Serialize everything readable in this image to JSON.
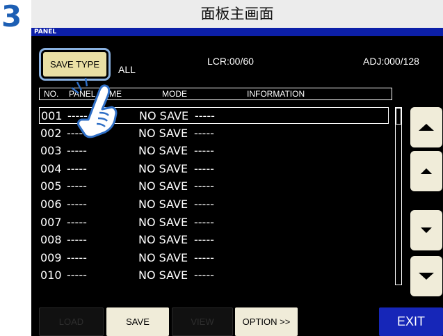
{
  "step_number": "3",
  "caption": "面板主画面",
  "screen": {
    "window_title": "PANEL",
    "save_type_label": "SAVE TYPE",
    "save_type_value": "ALL",
    "lcr_count": "LCR:00/60",
    "adj_count": "ADJ:000/128",
    "columns": [
      "NO.",
      "PANEL NAME",
      "MODE",
      "INFORMATION"
    ],
    "rows": [
      {
        "no": "001",
        "dash1": "-----",
        "status": "NO SAVE",
        "dash2": "-----"
      },
      {
        "no": "002",
        "dash1": "-----",
        "status": "NO SAVE",
        "dash2": "-----"
      },
      {
        "no": "003",
        "dash1": "-----",
        "status": "NO SAVE",
        "dash2": "-----"
      },
      {
        "no": "004",
        "dash1": "-----",
        "status": "NO SAVE",
        "dash2": "-----"
      },
      {
        "no": "005",
        "dash1": "-----",
        "status": "NO SAVE",
        "dash2": "-----"
      },
      {
        "no": "006",
        "dash1": "-----",
        "status": "NO SAVE",
        "dash2": "-----"
      },
      {
        "no": "007",
        "dash1": "-----",
        "status": "NO SAVE",
        "dash2": "-----"
      },
      {
        "no": "008",
        "dash1": "-----",
        "status": "NO SAVE",
        "dash2": "-----"
      },
      {
        "no": "009",
        "dash1": "-----",
        "status": "NO SAVE",
        "dash2": "-----"
      },
      {
        "no": "010",
        "dash1": "-----",
        "status": "NO SAVE",
        "dash2": "-----"
      }
    ],
    "selected_row_index": 0,
    "bottom_buttons": {
      "load": "LOAD",
      "save": "SAVE",
      "view": "VIEW",
      "option": "OPTION >>",
      "exit": "EXIT"
    },
    "scroll_buttons": [
      "page-up-icon",
      "line-up-icon",
      "line-down-icon",
      "page-down-icon"
    ]
  },
  "colors": {
    "title_bar": "#0c1fa8",
    "button_active": "#f0ecd9",
    "save_type_button": "#e9dfa4",
    "save_type_border": "#8ab1e0",
    "exit_button": "#1626b8",
    "step_number": "#1d5fb4",
    "pointer_hand_outline": "#2f6fc6"
  }
}
